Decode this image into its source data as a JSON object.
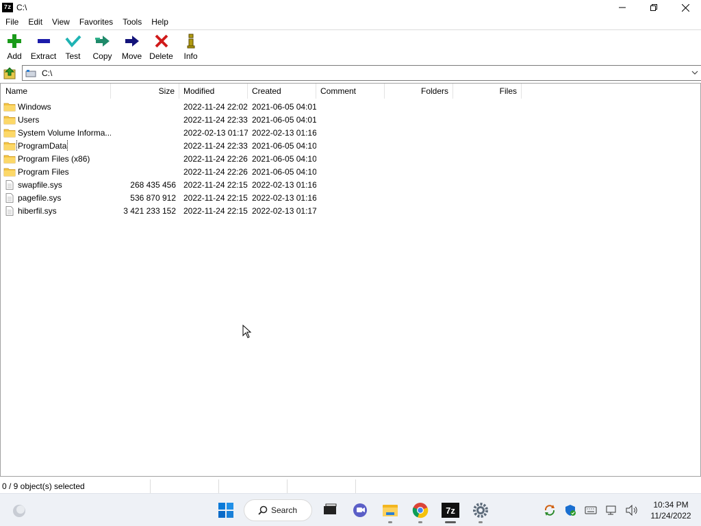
{
  "window": {
    "title": "C:\\",
    "app_icon_text": "7z"
  },
  "menu": [
    "File",
    "Edit",
    "View",
    "Favorites",
    "Tools",
    "Help"
  ],
  "toolbar": [
    {
      "label": "Add",
      "icon": "plus-icon",
      "color": "#1a9a1a"
    },
    {
      "label": "Extract",
      "icon": "minus-icon",
      "color": "#1b1baa"
    },
    {
      "label": "Test",
      "icon": "check-icon",
      "color": "#1fb3b3"
    },
    {
      "label": "Copy",
      "icon": "double-arrow-icon",
      "color": "#1f8a6a"
    },
    {
      "label": "Move",
      "icon": "arrow-right-icon",
      "color": "#14147a"
    },
    {
      "label": "Delete",
      "icon": "x-icon",
      "color": "#d01a1a"
    },
    {
      "label": "Info",
      "icon": "info-icon",
      "color": "#b09a10"
    }
  ],
  "address": {
    "path": "C:\\"
  },
  "columns": {
    "name": "Name",
    "size": "Size",
    "modified": "Modified",
    "created": "Created",
    "comment": "Comment",
    "folders": "Folders",
    "files": "Files"
  },
  "rows": [
    {
      "name": "Windows",
      "type": "folder",
      "size": "",
      "modified": "2022-11-24 22:02",
      "created": "2021-06-05 04:01"
    },
    {
      "name": "Users",
      "type": "folder",
      "size": "",
      "modified": "2022-11-24 22:33",
      "created": "2021-06-05 04:01"
    },
    {
      "name": "System Volume Informa...",
      "type": "folder",
      "size": "",
      "modified": "2022-02-13 01:17",
      "created": "2022-02-13 01:16"
    },
    {
      "name": "ProgramData",
      "type": "folder",
      "size": "",
      "modified": "2022-11-24 22:33",
      "created": "2021-06-05 04:10",
      "focused": true
    },
    {
      "name": "Program Files (x86)",
      "type": "folder",
      "size": "",
      "modified": "2022-11-24 22:26",
      "created": "2021-06-05 04:10"
    },
    {
      "name": "Program Files",
      "type": "folder",
      "size": "",
      "modified": "2022-11-24 22:26",
      "created": "2021-06-05 04:10"
    },
    {
      "name": "swapfile.sys",
      "type": "file",
      "size": "268 435 456",
      "modified": "2022-11-24 22:15",
      "created": "2022-02-13 01:16"
    },
    {
      "name": "pagefile.sys",
      "type": "file",
      "size": "536 870 912",
      "modified": "2022-11-24 22:15",
      "created": "2022-02-13 01:16"
    },
    {
      "name": "hiberfil.sys",
      "type": "file",
      "size": "3 421 233 152",
      "modified": "2022-11-24 22:15",
      "created": "2022-02-13 01:17"
    }
  ],
  "status": {
    "selection": "0 / 9 object(s) selected"
  },
  "taskbar": {
    "search_label": "Search",
    "clock_time": "10:34 PM",
    "clock_date": "11/24/2022"
  },
  "colors": {
    "folder": "#f5c542",
    "accent": "#0067c0"
  }
}
